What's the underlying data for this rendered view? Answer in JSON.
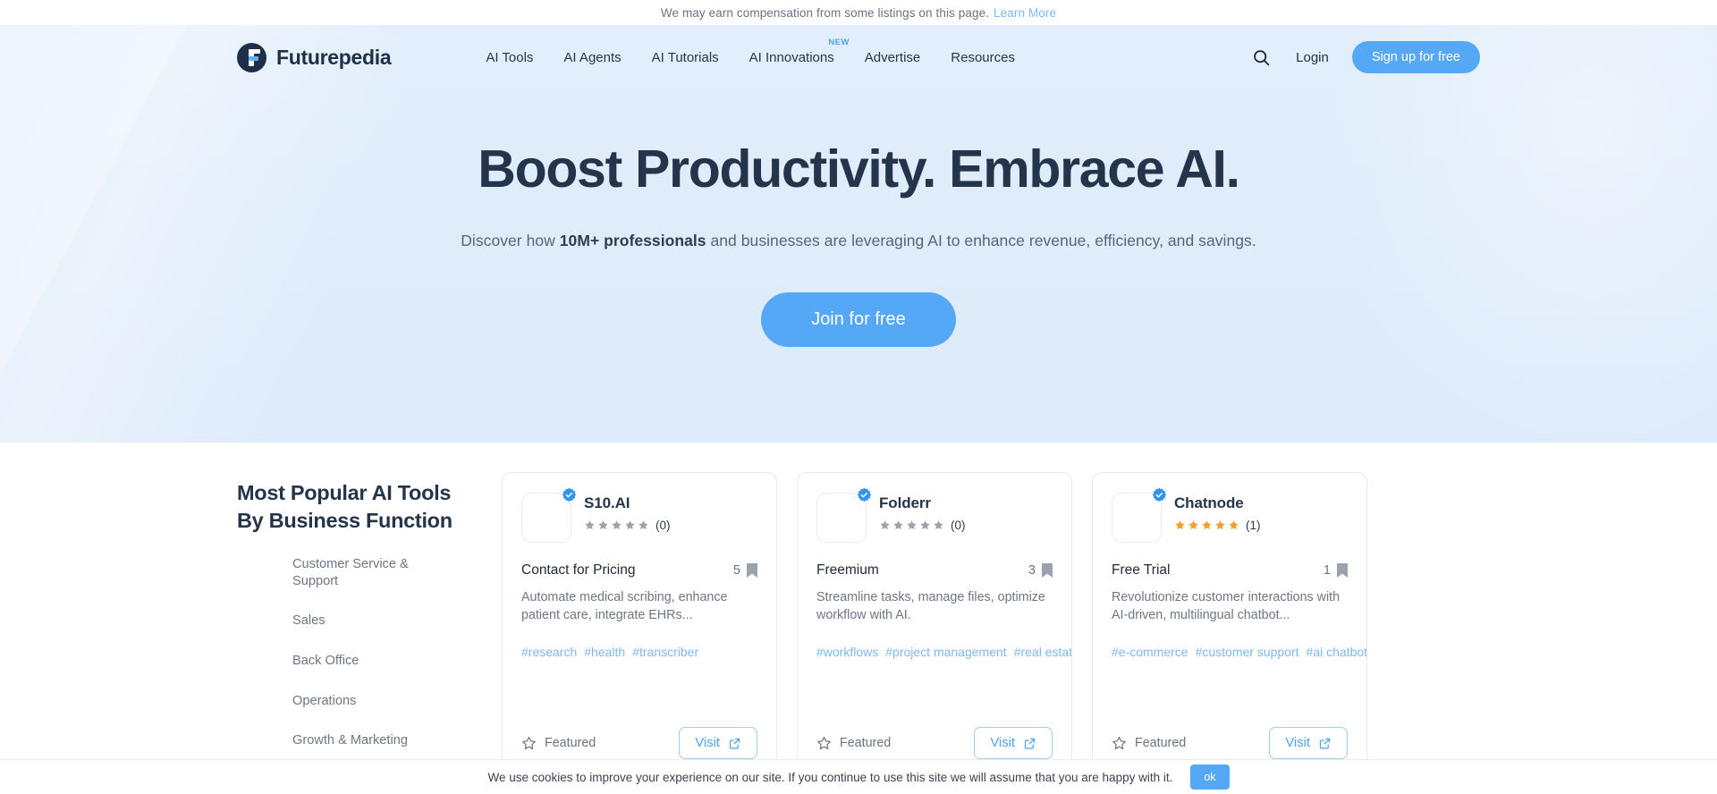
{
  "disclaimer": {
    "text": "We may earn compensation from some listings on this page.",
    "link_label": "Learn More"
  },
  "nav": {
    "brand_name": "Futurepedia",
    "links": [
      {
        "label": "AI Tools",
        "badge": ""
      },
      {
        "label": "AI Agents",
        "badge": ""
      },
      {
        "label": "AI Tutorials",
        "badge": ""
      },
      {
        "label": "AI Innovations",
        "badge": "NEW"
      },
      {
        "label": "Advertise",
        "badge": ""
      },
      {
        "label": "Resources",
        "badge": ""
      }
    ],
    "search_icon": "search-icon",
    "login_label": "Login",
    "signup_label": "Sign up for free"
  },
  "hero": {
    "title": "Boost Productivity. Embrace AI.",
    "sub_pre": "Discover how ",
    "sub_bold": "10M+ professionals",
    "sub_post": " and businesses are leveraging AI to enhance revenue, efficiency, and savings.",
    "cta_label": "Join for free"
  },
  "tools": {
    "heading": "Most Popular AI Tools By Business Function",
    "functions": [
      "Customer Service & Support",
      "Sales",
      "Back Office",
      "Operations",
      "Growth & Marketing"
    ],
    "cards": [
      {
        "name": "S10.AI",
        "verified": true,
        "stars": 5,
        "star_color": "#9ca3af",
        "rating_count": "(0)",
        "price": "Contact for Pricing",
        "save_count": "5",
        "description": "Automate medical scribing, enhance patient care, integrate EHRs...",
        "tags": [
          "#research",
          "#health",
          "#transcriber"
        ],
        "featured_label": "Featured",
        "visit_label": "Visit"
      },
      {
        "name": "Folderr",
        "verified": true,
        "stars": 5,
        "star_color": "#9ca3af",
        "rating_count": "(0)",
        "price": "Freemium",
        "save_count": "3",
        "description": "Streamline tasks, manage files, optimize workflow with AI.",
        "tags": [
          "#workflows",
          "#project management",
          "#real estate"
        ],
        "featured_label": "Featured",
        "visit_label": "Visit"
      },
      {
        "name": "Chatnode",
        "verified": true,
        "stars": 5,
        "star_color": "#f59e2e",
        "rating_count": "(1)",
        "price": "Free Trial",
        "save_count": "1",
        "description": "Revolutionize customer interactions with AI-driven, multilingual chatbot...",
        "tags": [
          "#e-commerce",
          "#customer support",
          "#ai chatbots"
        ],
        "featured_label": "Featured",
        "visit_label": "Visit"
      }
    ]
  },
  "cookie": {
    "text": "We use cookies to improve your experience on our site. If you continue to use this site we will assume that you are happy with it.",
    "ok_label": "ok"
  },
  "colors": {
    "accent_blue": "#55a8f5",
    "link_blue": "#7cb8f0",
    "dark_navy": "#24344a",
    "star_orange": "#f59e2e",
    "star_grey": "#9ca3af"
  }
}
